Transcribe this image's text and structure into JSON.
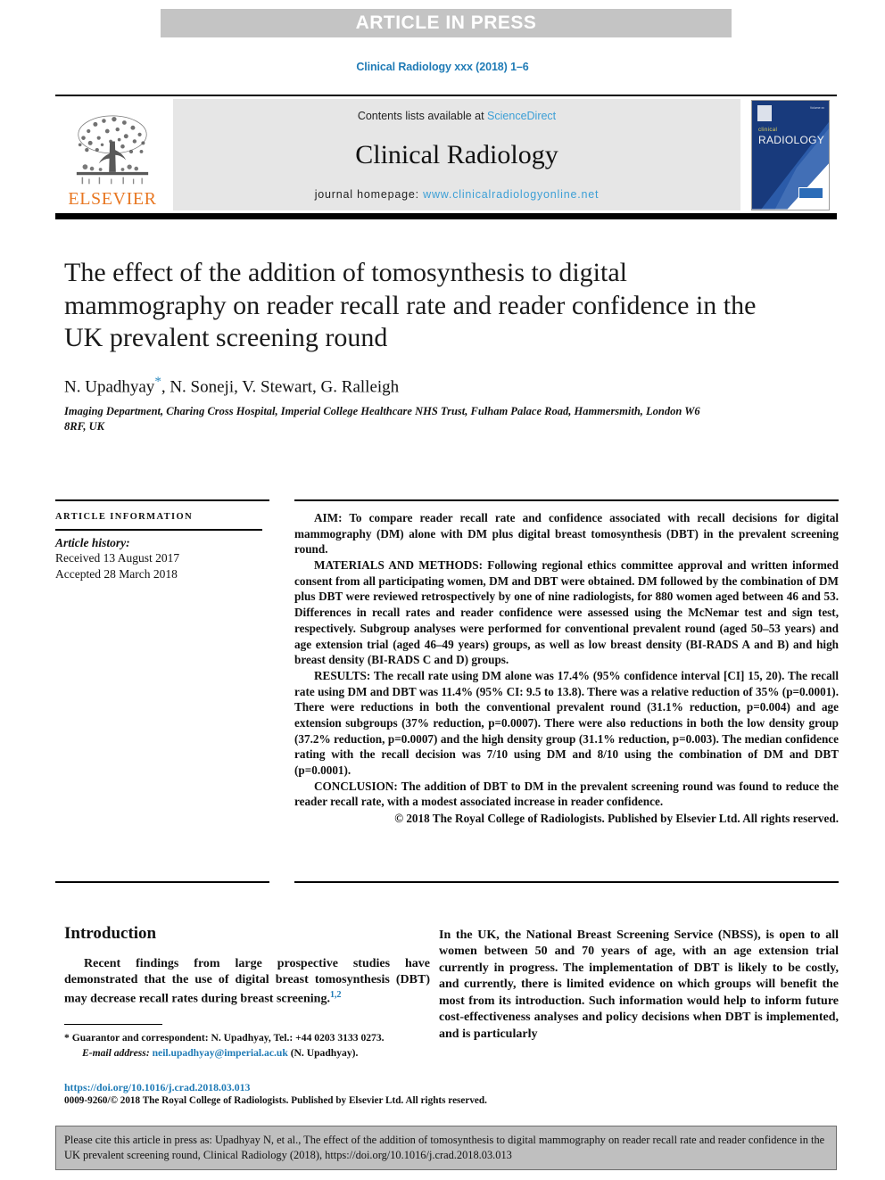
{
  "banner": {
    "text": "ARTICLE IN PRESS"
  },
  "journal_ref": "Clinical Radiology xxx (2018) 1–6",
  "masthead": {
    "elsevier_logo_label": "ELSEVIER",
    "contents_prefix": "Contents lists available at ",
    "sciencedirect": "ScienceDirect",
    "journal_title": "Clinical Radiology",
    "homepage_prefix": "journal homepage: ",
    "homepage_url": "www.clinicalradiologyonline.net",
    "cover": {
      "small_title": "clinical",
      "big_title": "RADIOLOGY",
      "corner_note": "Volume xx"
    }
  },
  "article": {
    "title": "The effect of the addition of tomosynthesis to digital mammography on reader recall rate and reader confidence in the UK prevalent screening round",
    "authors": "N. Upadhyay",
    "authors_rest": ", N. Soneji, V. Stewart, G. Ralleigh",
    "corresponding_marker": "*",
    "affiliation": "Imaging Department, Charing Cross Hospital, Imperial College Healthcare NHS Trust, Fulham Palace Road, Hammersmith, London W6 8RF, UK"
  },
  "article_information": {
    "heading": "ARTICLE INFORMATION",
    "history_label": "Article history:",
    "received": "Received 13 August 2017",
    "accepted": "Accepted 28 March 2018"
  },
  "abstract": {
    "aim": "AIM: To compare reader recall rate and confidence associated with recall decisions for digital mammography (DM) alone with DM plus digital breast tomosynthesis (DBT) in the prevalent screening round.",
    "materials": "MATERIALS AND METHODS: Following regional ethics committee approval and written informed consent from all participating women, DM and DBT were obtained. DM followed by the combination of DM plus DBT were reviewed retrospectively by one of nine radiologists, for 880 women aged between 46 and 53. Differences in recall rates and reader confidence were assessed using the McNemar test and sign test, respectively. Subgroup analyses were performed for conventional prevalent round (aged 50–53 years) and age extension trial (aged 46–49 years) groups, as well as low breast density (BI-RADS A and B) and high breast density (BI-RADS C and D) groups.",
    "results": "RESULTS: The recall rate using DM alone was 17.4% (95% confidence interval [CI] 15, 20). The recall rate using DM and DBT was 11.4% (95% CI: 9.5 to 13.8). There was a relative reduction of 35% (p=0.0001). There were reductions in both the conventional prevalent round (31.1% reduction, p=0.004) and age extension subgroups (37% reduction, p=0.0007). There were also reductions in both the low density group (37.2% reduction, p=0.0007) and the high density group (31.1% reduction, p=0.003). The median confidence rating with the recall decision was 7/10 using DM and 8/10 using the combination of DM and DBT (p=0.0001).",
    "conclusion": "CONCLUSION: The addition of DBT to DM in the prevalent screening round was found to reduce the reader recall rate, with a modest associated increase in reader confidence.",
    "copyright": "© 2018 The Royal College of Radiologists. Published by Elsevier Ltd. All rights reserved."
  },
  "body": {
    "introduction_heading": "Introduction",
    "intro_paragraph_left": "Recent findings from large prospective studies have demonstrated that the use of digital breast tomosynthesis (DBT) may decrease recall rates during breast screening.",
    "intro_reference_superscript": "1,2",
    "intro_paragraph_right": "In the UK, the National Breast Screening Service (NBSS), is open to all women between 50 and 70 years of age, with an age extension trial currently in progress. The implementation of DBT is likely to be costly, and currently, there is limited evidence on which groups will benefit the most from its introduction. Such information would help to inform future cost-effectiveness analyses and policy decisions when DBT is implemented, and is particularly"
  },
  "footnote": {
    "marker": "*",
    "guarantor": " Guarantor and correspondent: N. Upadhyay, Tel.: +44 0203 3133 0273.",
    "email_label": "E-mail address:",
    "email": "neil.upadhyay@imperial.ac.uk",
    "email_suffix": " (N. Upadhyay)."
  },
  "doi_footer": {
    "doi_url": "https://doi.org/10.1016/j.crad.2018.03.013",
    "issn_line": "0009-9260/© 2018 The Royal College of Radiologists. Published by Elsevier Ltd. All rights reserved."
  },
  "cite_box": {
    "text": "Please cite this article in press as: Upadhyay N, et al., The effect of the addition of tomosynthesis to digital mammography on reader recall rate and reader confidence in the UK prevalent screening round, Clinical Radiology (2018), https://doi.org/10.1016/j.crad.2018.03.013"
  },
  "colors": {
    "banner_gray": "#c4c4c4",
    "masthead_gray": "#e6e6e6",
    "link_blue": "#3c9fd6",
    "ref_blue": "#1f7bb6",
    "elsevier_orange": "#E87722",
    "cite_box_gray": "#bfbfbf",
    "cover_navy": "#183a7c"
  }
}
